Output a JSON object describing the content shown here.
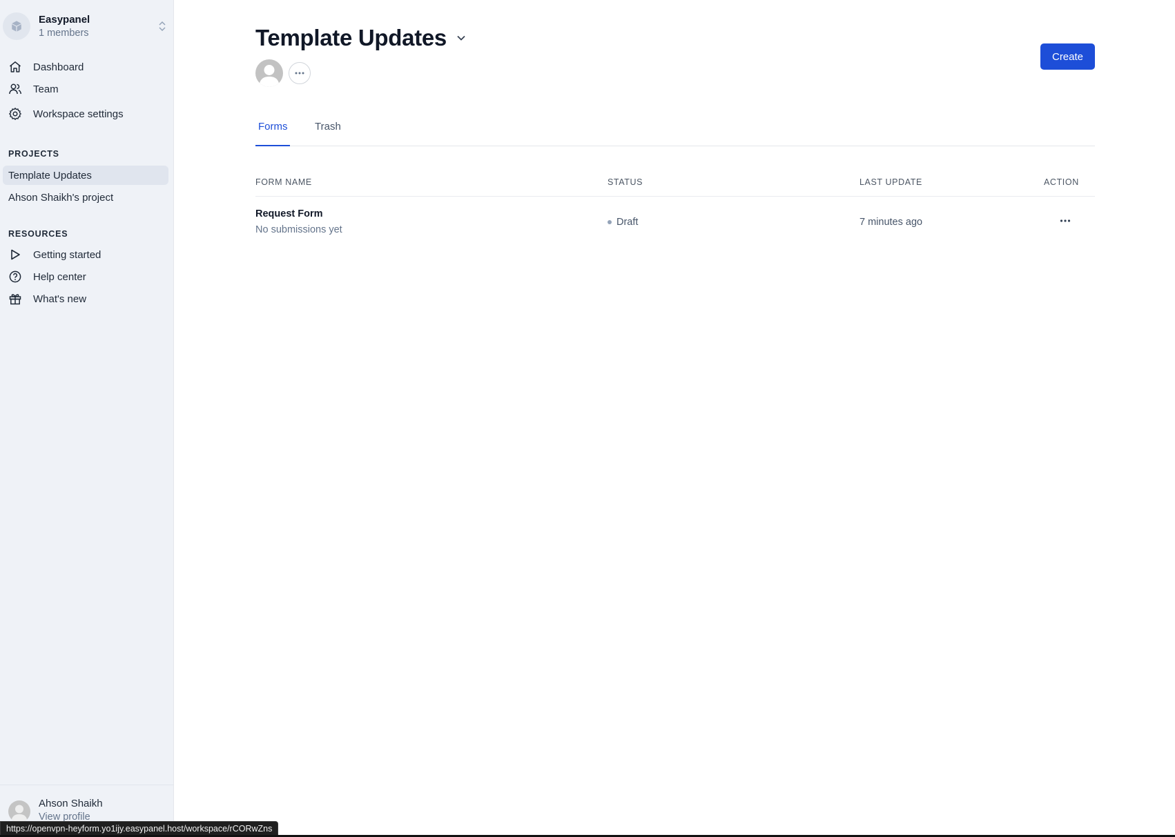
{
  "workspace": {
    "name": "Easypanel",
    "members": "1 members",
    "icon": "box-icon"
  },
  "sidebar": {
    "nav": [
      {
        "label": "Dashboard",
        "icon": "home-icon"
      },
      {
        "label": "Team",
        "icon": "users-icon"
      },
      {
        "label": "Workspace settings",
        "icon": "gear-icon"
      }
    ],
    "projects_title": "PROJECTS",
    "projects": [
      {
        "label": "Template Updates",
        "active": true
      },
      {
        "label": "Ahson Shaikh's project",
        "active": false
      }
    ],
    "resources_title": "RESOURCES",
    "resources": [
      {
        "label": "Getting started",
        "icon": "play-icon"
      },
      {
        "label": "Help center",
        "icon": "help-circle-icon"
      },
      {
        "label": "What's new",
        "icon": "gift-icon"
      }
    ],
    "user": {
      "name": "Ahson Shaikh",
      "link": "View profile"
    }
  },
  "header": {
    "title": "Template Updates",
    "create_label": "Create"
  },
  "tabs": [
    {
      "label": "Forms",
      "active": true
    },
    {
      "label": "Trash",
      "active": false
    }
  ],
  "table": {
    "columns": [
      "FORM NAME",
      "STATUS",
      "LAST UPDATE",
      "ACTION"
    ],
    "rows": [
      {
        "name": "Request Form",
        "subtitle": "No submissions yet",
        "status": "Draft",
        "last_update": "7 minutes ago"
      }
    ]
  },
  "statusbar": {
    "url": "https://openvpn-heyform.yo1ijy.easypanel.host/workspace/rCORwZns"
  },
  "colors": {
    "accent": "#1d4ed8",
    "sidebar_bg": "#eff2f7",
    "draft_dot": "#94a3b8"
  }
}
